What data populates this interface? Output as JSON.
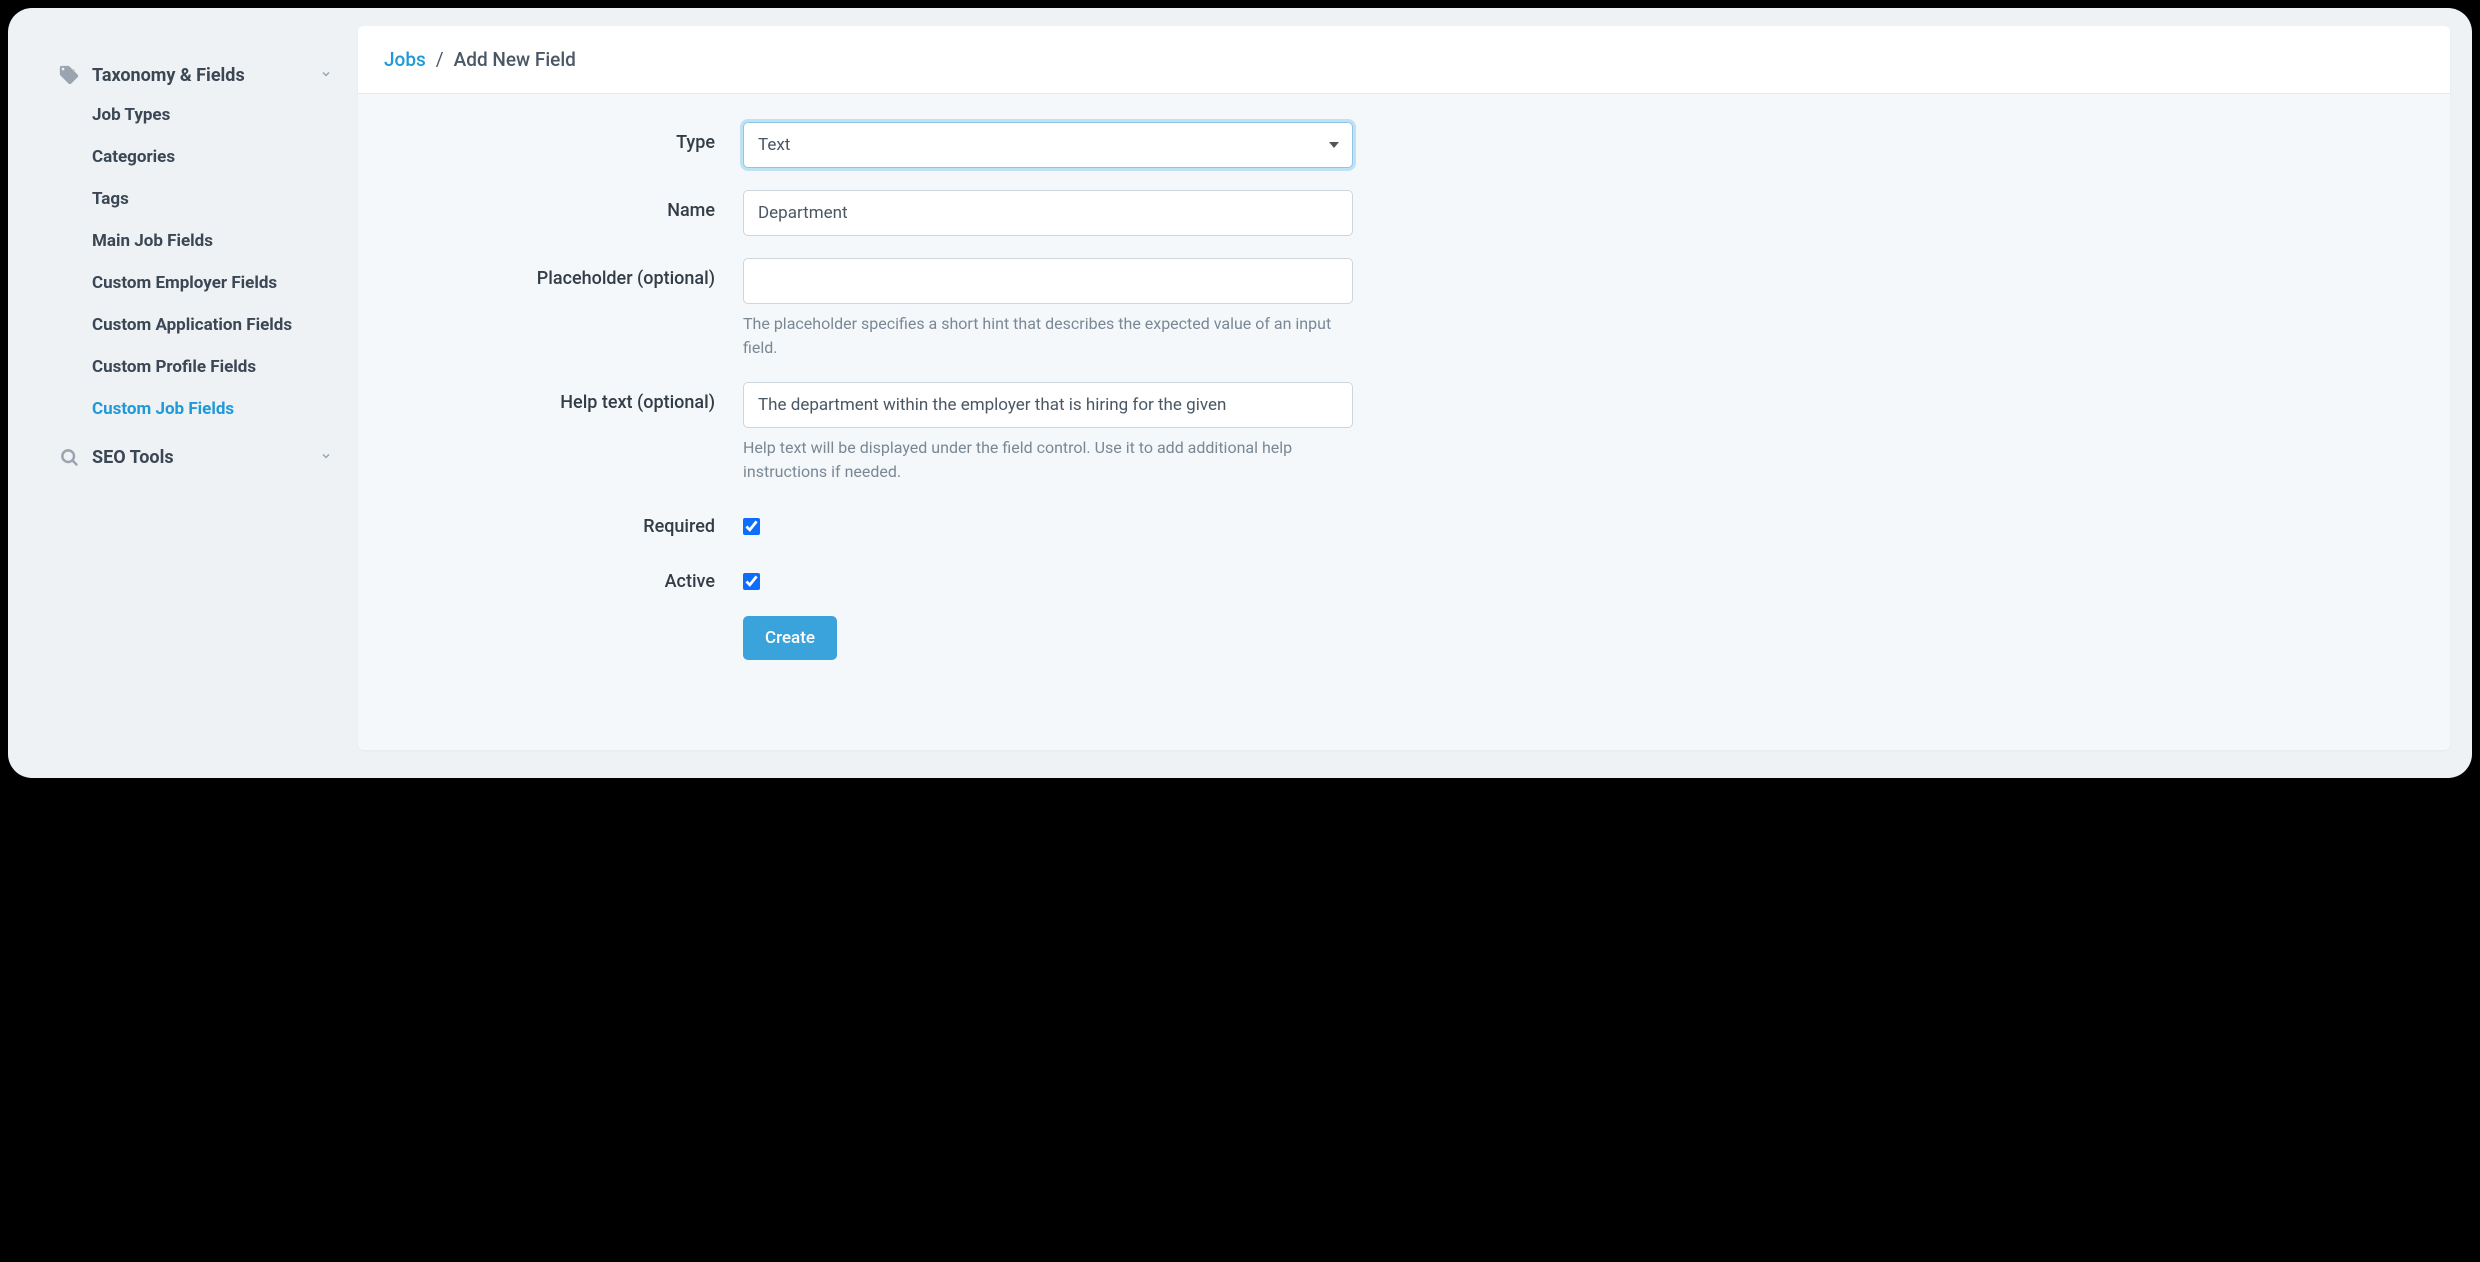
{
  "sidebar": {
    "sections": [
      {
        "title": "Taxonomy & Fields",
        "icon": "tag-icon",
        "expanded": true,
        "items": [
          {
            "label": "Job Types",
            "active": false
          },
          {
            "label": "Categories",
            "active": false
          },
          {
            "label": "Tags",
            "active": false
          },
          {
            "label": "Main Job Fields",
            "active": false
          },
          {
            "label": "Custom Employer Fields",
            "active": false
          },
          {
            "label": "Custom Application Fields",
            "active": false
          },
          {
            "label": "Custom Profile Fields",
            "active": false
          },
          {
            "label": "Custom Job Fields",
            "active": true
          }
        ]
      },
      {
        "title": "SEO Tools",
        "icon": "search-icon",
        "expanded": false,
        "items": []
      }
    ]
  },
  "breadcrumb": {
    "root": "Jobs",
    "separator": "/",
    "current": "Add New Field"
  },
  "form": {
    "type": {
      "label": "Type",
      "value": "Text"
    },
    "name": {
      "label": "Name",
      "value": "Department"
    },
    "placeholder": {
      "label": "Placeholder (optional)",
      "value": "",
      "help": "The placeholder specifies a short hint that describes the expected value of an input field."
    },
    "helptext": {
      "label": "Help text (optional)",
      "value": "The department within the employer that is hiring for the given",
      "help": "Help text will be displayed under the field control. Use it to add additional help instructions if needed."
    },
    "required": {
      "label": "Required",
      "checked": true
    },
    "active": {
      "label": "Active",
      "checked": true
    },
    "submit": "Create"
  }
}
